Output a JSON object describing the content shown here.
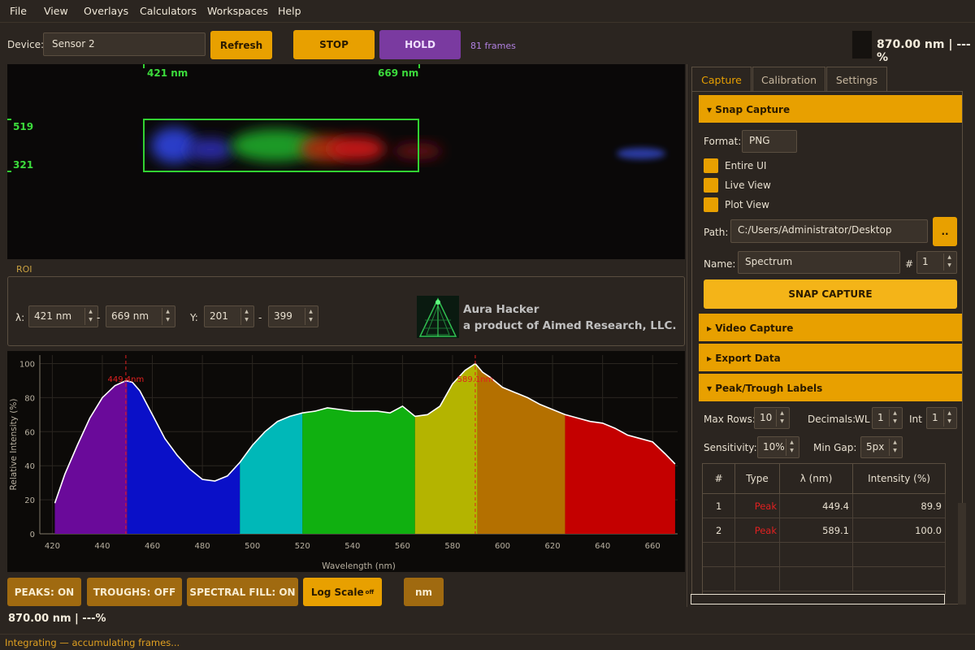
{
  "menu": [
    "File",
    "View",
    "Overlays",
    "Calculators",
    "Workspaces",
    "Help"
  ],
  "toolbar": {
    "device_label": "Device:",
    "device_value": "Sensor 2",
    "refresh": "Refresh",
    "stop": "STOP",
    "hold": "HOLD",
    "frames": "81 frames",
    "readout": "870.00 nm | ---%"
  },
  "camera": {
    "wl_start": "421 nm",
    "wl_end": "669 nm",
    "y_top": "519",
    "y_bottom": "321"
  },
  "roi": {
    "title": "ROI",
    "lambda_label": "λ:",
    "lambda_min": "421 nm",
    "lambda_max": "669 nm",
    "dash": "-",
    "y_label": "Y:",
    "y_min": "201",
    "y_max": "399",
    "brand_name": "Aura Hacker",
    "brand_sub": "a product of Aimed Research, LLC."
  },
  "chart_data": {
    "type": "area",
    "xlabel": "Wavelength (nm)",
    "ylabel": "Relative Intensity (%)",
    "xlim": [
      415,
      670
    ],
    "ylim": [
      0,
      105
    ],
    "xticks": [
      420,
      440,
      460,
      480,
      500,
      520,
      540,
      560,
      580,
      600,
      620,
      640,
      660
    ],
    "yticks": [
      0,
      20,
      40,
      60,
      80,
      100
    ],
    "x": [
      421,
      425,
      430,
      435,
      440,
      445,
      449.4,
      452,
      455,
      460,
      465,
      470,
      475,
      480,
      485,
      490,
      495,
      500,
      505,
      510,
      515,
      520,
      525,
      530,
      535,
      540,
      545,
      550,
      555,
      560,
      565,
      570,
      575,
      580,
      585,
      589.1,
      592,
      595,
      600,
      605,
      610,
      615,
      620,
      625,
      630,
      635,
      640,
      645,
      650,
      655,
      660,
      665,
      669
    ],
    "y": [
      18,
      35,
      52,
      68,
      80,
      87,
      89.9,
      89,
      84,
      70,
      56,
      46,
      38,
      32,
      31,
      34,
      42,
      52,
      60,
      66,
      69,
      71,
      72,
      74,
      73,
      72,
      72,
      72,
      71,
      75,
      69,
      70,
      75,
      88,
      96,
      100.0,
      95,
      92,
      86,
      83,
      80,
      76,
      73,
      70,
      68,
      66,
      65,
      62,
      58,
      56,
      54,
      47,
      41
    ],
    "peaks": [
      {
        "x": 449.4,
        "label": "449.4nm"
      },
      {
        "x": 589.1,
        "label": "589.1nm"
      }
    ],
    "bands": [
      {
        "from": 421,
        "to": 450,
        "color": "#6a0a9a"
      },
      {
        "from": 450,
        "to": 495,
        "color": "#0a10c8"
      },
      {
        "from": 495,
        "to": 520,
        "color": "#00b8b8"
      },
      {
        "from": 520,
        "to": 565,
        "color": "#10b010"
      },
      {
        "from": 565,
        "to": 590,
        "color": "#b4b400"
      },
      {
        "from": 590,
        "to": 625,
        "color": "#b47000"
      },
      {
        "from": 625,
        "to": 669,
        "color": "#c40000"
      }
    ]
  },
  "plot_buttons": {
    "peaks": "PEAKS: ON",
    "troughs": "TROUGHS: OFF",
    "fill": "SPECTRAL FILL: ON",
    "log": "Log Scale",
    "log_state": "off",
    "unit": "nm"
  },
  "bottom_readout": "870.00 nm | ---%",
  "status": "Integrating — accumulating frames...",
  "panel": {
    "tabs": [
      "Capture",
      "Calibration",
      "Settings"
    ],
    "snap": {
      "header": "▾ Snap Capture",
      "format_label": "Format:",
      "format_value": "PNG",
      "opt_entire": "Entire UI",
      "opt_live": "Live View",
      "opt_plot": "Plot View",
      "path_label": "Path:",
      "path_value": "C:/Users/Administrator/Desktop",
      "browse": "..",
      "name_label": "Name:",
      "name_value": "Spectrum",
      "num_label": "#",
      "num_value": "1",
      "button": "SNAP CAPTURE"
    },
    "video_header": "▸ Video Capture",
    "export_header": "▸ Export Data",
    "peak": {
      "header": "▾ Peak/Trough Labels",
      "max_rows_label": "Max Rows:",
      "max_rows_value": "10",
      "decimals_label": "Decimals:",
      "wl_label": "WL",
      "wl_value": "1",
      "int_label": "Int",
      "int_value": "1",
      "sens_label": "Sensitivity:",
      "sens_value": "10%",
      "gap_label": "Min Gap:",
      "gap_value": "5px",
      "columns": [
        "#",
        "Type",
        "λ (nm)",
        "Intensity (%)"
      ],
      "rows": [
        {
          "n": "1",
          "type": "Peak",
          "wl": "449.4",
          "int": "89.9"
        },
        {
          "n": "2",
          "type": "Peak",
          "wl": "589.1",
          "int": "100.0"
        }
      ]
    }
  },
  "colors": {
    "accent": "#e8a000",
    "hold": "#7a3aa0",
    "roi_green": "#32d232",
    "peak_red": "#e02020"
  }
}
